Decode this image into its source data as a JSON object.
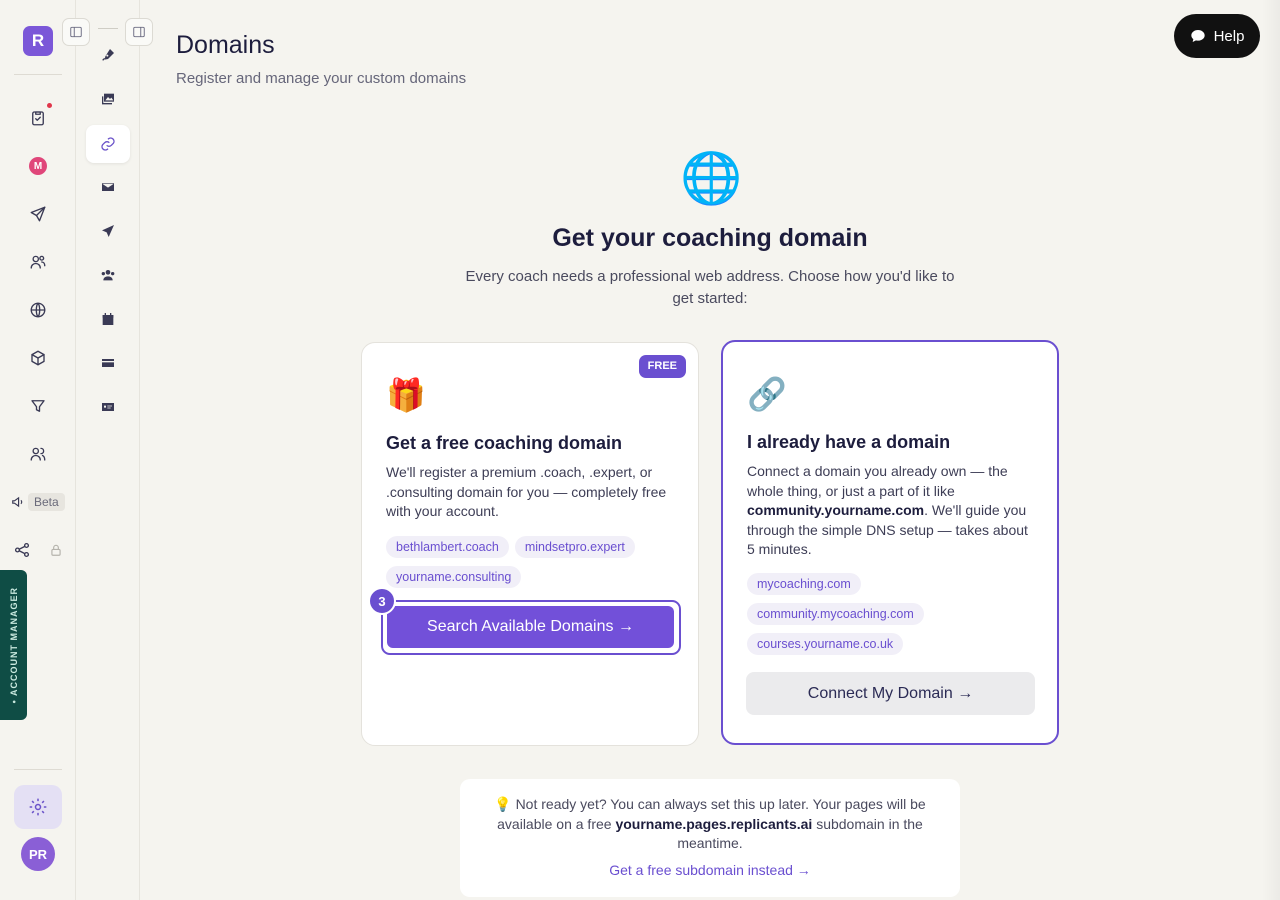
{
  "rail": {
    "logo_letter": "R",
    "beta_label": "Beta",
    "account_manager_label": "• ACCOUNT MANAGER",
    "avatar_initials": "PR",
    "m_badge": "M",
    "icons": [
      "clipboard-check-icon",
      "m-badge-icon",
      "send-icon",
      "users-group-icon",
      "globe-icon",
      "box-icon",
      "filter-icon",
      "people-icon",
      "megaphone-icon",
      "share-icon"
    ]
  },
  "subnav": {
    "icons": [
      "pen-nib-icon",
      "images-icon",
      "link-icon",
      "envelope-icon",
      "paper-plane-icon",
      "users-icon",
      "calendar-check-icon",
      "credit-card-icon",
      "id-card-icon"
    ],
    "active": "link-icon"
  },
  "header": {
    "title": "Domains",
    "subtitle": "Register and manage your custom domains",
    "help_label": "Help"
  },
  "hero": {
    "emoji": "🌐",
    "title": "Get your coaching domain",
    "subtitle": "Every coach needs a professional web address. Choose how you'd like to get started:"
  },
  "card_free": {
    "badge": "FREE",
    "emoji": "🎁",
    "title": "Get a free coaching domain",
    "description": "We'll register a premium .coach, .expert, or .consulting domain for you — completely free with your account.",
    "chips": [
      "bethlambert.coach",
      "mindsetpro.expert",
      "yourname.consulting"
    ],
    "step_number": "3",
    "button_label": "Search Available Domains →"
  },
  "card_have": {
    "emoji": "🔗",
    "title": "I already have a domain",
    "description_pre": "Connect a domain you already own — the whole thing, or just a part of it like ",
    "description_bold": "community.yourname.com",
    "description_post": ". We'll guide you through the simple DNS setup — takes about 5 minutes.",
    "chips": [
      "mycoaching.com",
      "community.mycoaching.com",
      "courses.yourname.co.uk"
    ],
    "button_label": "Connect My Domain →"
  },
  "note": {
    "text_pre": "💡 Not ready yet? You can always set this up later. Your pages will be available on a free ",
    "text_bold": "yourname.pages.replicants.ai",
    "text_post": " subdomain in the meantime.",
    "link_label": "Get a free subdomain instead →"
  },
  "colors": {
    "accent": "#6a4fd0",
    "background": "#f5f4ef",
    "account_manager_tab": "#0f4d45"
  }
}
